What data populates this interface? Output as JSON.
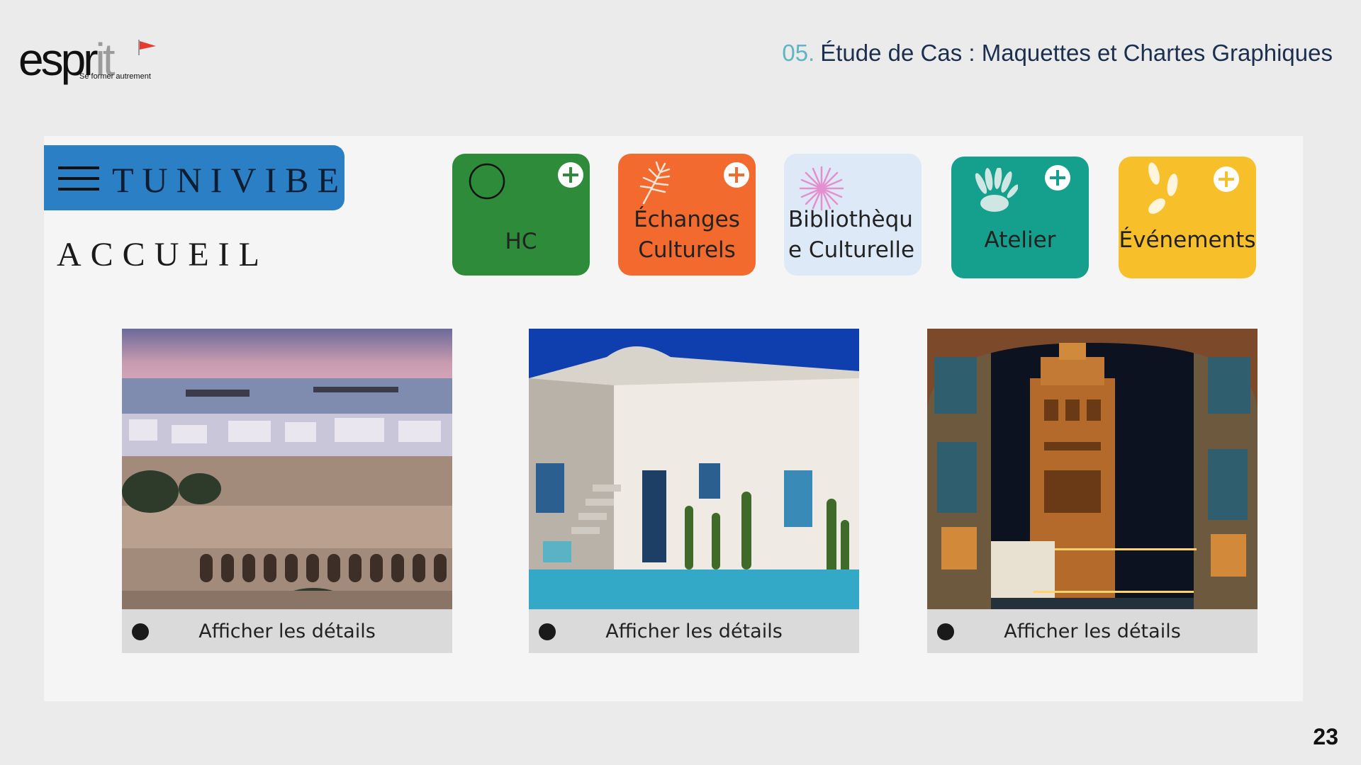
{
  "header": {
    "logo": {
      "word_main": "espr",
      "word_accent": "it",
      "tagline": "Se former autrement"
    },
    "slide_number": "05.",
    "slide_title": "Étude de Cas : Maquettes et Chartes Graphiques"
  },
  "app": {
    "brand": "TUNIVIBE",
    "page_heading": "ACCUEIL",
    "categories": [
      {
        "label": "HC",
        "color": "#2e8b3a",
        "icon": "circle-outline-icon",
        "has_plus": true
      },
      {
        "label": "Échanges Culturels",
        "color": "#f26a2e",
        "icon": "palm-leaf-icon",
        "has_plus": true
      },
      {
        "label": "Bibliothèque Culturelle",
        "color": "#dde9f6",
        "icon": "asterisk-flower-icon",
        "has_plus": false
      },
      {
        "label": "Atelier",
        "color": "#14a08c",
        "icon": "hands-icon",
        "has_plus": true
      },
      {
        "label": "Événements",
        "color": "#f7c02a",
        "icon": "leaves-icon",
        "has_plus": true
      }
    ],
    "cards": [
      {
        "image": "coastal-city-photo",
        "action": "Afficher les détails"
      },
      {
        "image": "white-house-pool-photo",
        "action": "Afficher les détails"
      },
      {
        "image": "minaret-night-photo",
        "action": "Afficher les détails"
      }
    ]
  },
  "page_number": "23"
}
